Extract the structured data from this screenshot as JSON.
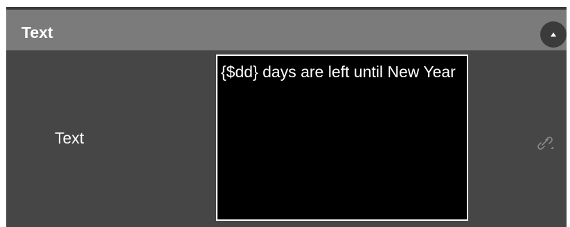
{
  "panel": {
    "title": "Text"
  },
  "field": {
    "label": "Text",
    "value": "{$dd} days are left until New Year"
  },
  "icons": {
    "collapse": "chevron-up-icon",
    "link": "link-icon"
  },
  "colors": {
    "panel_bg": "#464646",
    "header_bg": "#7b7b7b",
    "input_bg": "#000000",
    "input_border": "#ffffff",
    "text": "#ffffff"
  }
}
